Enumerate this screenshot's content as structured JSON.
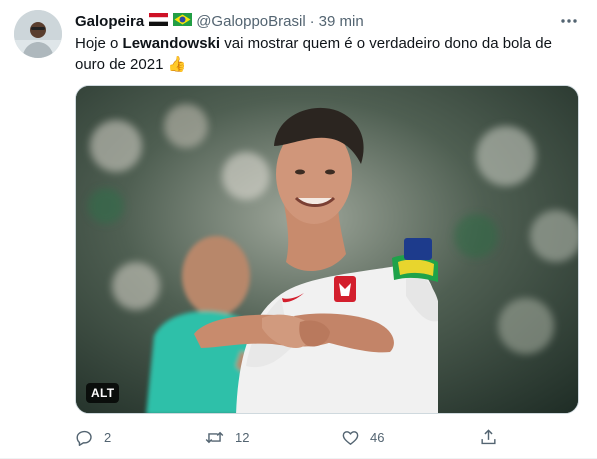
{
  "tweet": {
    "author": {
      "display_name": "Galopeira",
      "handle": "@GaloppoBrasil",
      "flags": [
        "yemen-flag",
        "brazil-flag"
      ]
    },
    "separator": "·",
    "time": "39 min",
    "text": {
      "before": "Hoje o ",
      "bold": "Lewandowski",
      "after": " vai mostrar quem é o verdadeiro dono da bola de ouro de 2021",
      "emoji": "👍"
    },
    "media": {
      "alt_badge": "ALT"
    },
    "actions": {
      "reply": {
        "icon": "reply-icon",
        "count": "2"
      },
      "retweet": {
        "icon": "retweet-icon",
        "count": "12"
      },
      "like": {
        "icon": "heart-icon",
        "count": "46"
      },
      "share": {
        "icon": "share-icon"
      }
    },
    "colors": {
      "text_primary": "#0f1419",
      "text_secondary": "#536471",
      "border": "#cfd9de"
    }
  }
}
